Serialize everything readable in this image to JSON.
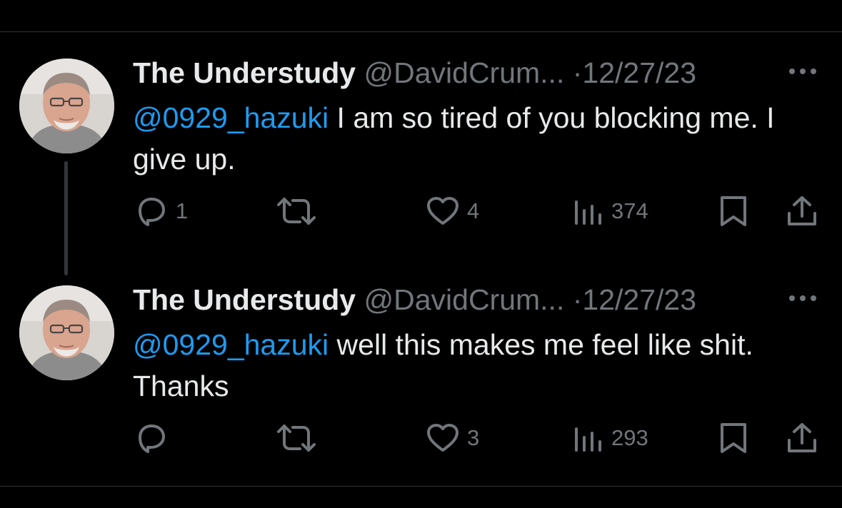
{
  "colors": {
    "background": "#000000",
    "text": "#e7e9ea",
    "muted": "#71767b",
    "mention": "#1d9bf0",
    "divider": "#2f3336"
  },
  "icons": {
    "reply": "speech-bubble",
    "retweet": "retweet-arrows",
    "like": "heart-outline",
    "views": "bar-chart",
    "bookmark": "bookmark-outline",
    "share": "share-upload",
    "more": "horizontal-ellipsis"
  },
  "tweets": [
    {
      "display_name": "The Understudy",
      "handle": "@DavidCrum...",
      "separator": "·",
      "date": "12/27/23",
      "mention": "@0929_hazuki",
      "text": " I am so tired of you blocking me. I give up.",
      "reply_count": "1",
      "retweet_count": "",
      "like_count": "4",
      "view_count": "374"
    },
    {
      "display_name": "The Understudy",
      "handle": "@DavidCrum...",
      "separator": "·",
      "date": "12/27/23",
      "mention": "@0929_hazuki",
      "text": " well this makes me feel like shit. Thanks",
      "reply_count": "",
      "retweet_count": "",
      "like_count": "3",
      "view_count": "293"
    }
  ]
}
